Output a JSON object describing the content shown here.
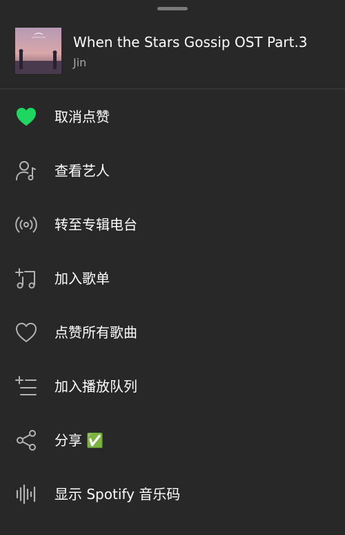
{
  "track": {
    "title": "When the Stars Gossip OST Part.3",
    "artist": "Jin"
  },
  "menu": {
    "items": [
      {
        "label": "取消点赞",
        "icon": "heart-filled-icon",
        "color": "#1ed760"
      },
      {
        "label": "查看艺人",
        "icon": "artist-icon"
      },
      {
        "label": "转至专辑电台",
        "icon": "radio-icon"
      },
      {
        "label": "加入歌单",
        "icon": "add-to-playlist-icon"
      },
      {
        "label": "点赞所有歌曲",
        "icon": "heart-outline-icon"
      },
      {
        "label": "加入播放队列",
        "icon": "add-to-queue-icon"
      },
      {
        "label": "分享 ✅",
        "icon": "share-icon"
      },
      {
        "label": "显示 Spotify 音乐码",
        "icon": "spotify-code-icon"
      }
    ]
  },
  "colors": {
    "background": "#282828",
    "accent": "#1ed760",
    "secondary_text": "#a7a7a7"
  }
}
